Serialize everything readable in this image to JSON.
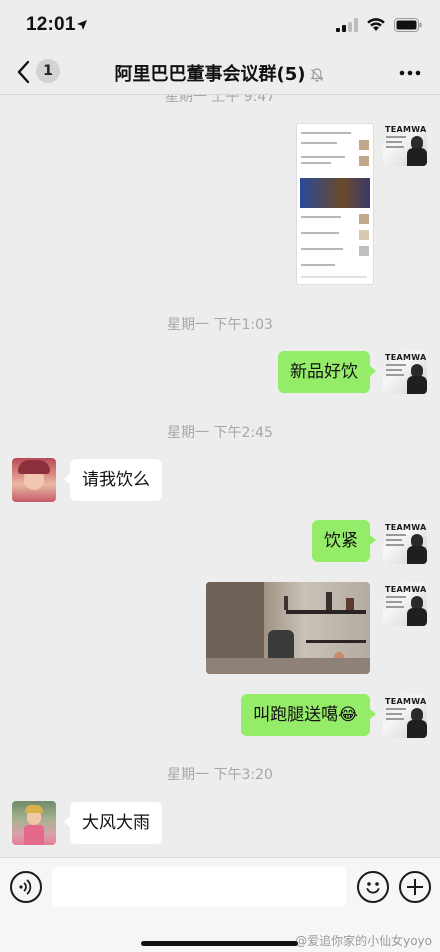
{
  "status_bar": {
    "time": "12:01"
  },
  "nav": {
    "back_count": "1",
    "title": "阿里巴巴董事会议群(5)"
  },
  "messages": {
    "ts_cut": "星期一 上午 9:47",
    "ts1": "星期一 下午1:03",
    "msg1": "新品好饮",
    "ts2": "星期一 下午2:45",
    "msg2": "请我饮么",
    "msg3": "饮紧",
    "msg4": "叫跑腿送噶",
    "msg4_emoji": "😂",
    "ts3": "星期一 下午3:20",
    "msg5": "大风大雨"
  },
  "avatar_self_text": "TEAMWANG",
  "watermark": "@爱追你家的小仙女yoyo"
}
